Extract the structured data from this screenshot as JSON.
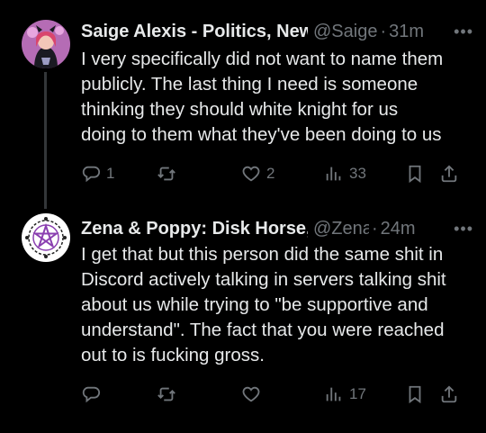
{
  "tweets": [
    {
      "author_name": "Saige Alexis - Politics, New",
      "handle": "@Saige",
      "separator": "·",
      "time": "31m",
      "more": "•••",
      "text": "I very specifically did not want to name them\npublicly. The last thing I need is someone\nthinking they should white knight for us\ndoing to them what they've been doing to us",
      "reply_count": "1",
      "retweet_count": "",
      "like_count": "2",
      "view_count": "33"
    },
    {
      "author_name": "Zena & Poppy: Disk Horse,",
      "handle": "@Zena",
      "separator": "·",
      "time": "24m",
      "more": "•••",
      "text": "I get that but this person did the same shit in\nDiscord actively talking in servers talking shit\nabout us while trying to \"be supportive and\nunderstand\". The fact that you were reached\nout to is fucking gross.",
      "reply_count": "",
      "retweet_count": "",
      "like_count": "",
      "view_count": "17"
    }
  ],
  "icons": {
    "reply": "reply-icon",
    "retweet": "retweet-icon",
    "like": "heart-icon",
    "views": "views-icon",
    "bookmark": "bookmark-icon",
    "share": "share-icon"
  },
  "colors": {
    "background": "#000000",
    "text": "#e7e9ea",
    "secondary": "#71767b",
    "avatar1_bg": "#b36bb3",
    "avatar2_bg": "#ffffff",
    "pentagram": "#8a3fb0"
  }
}
